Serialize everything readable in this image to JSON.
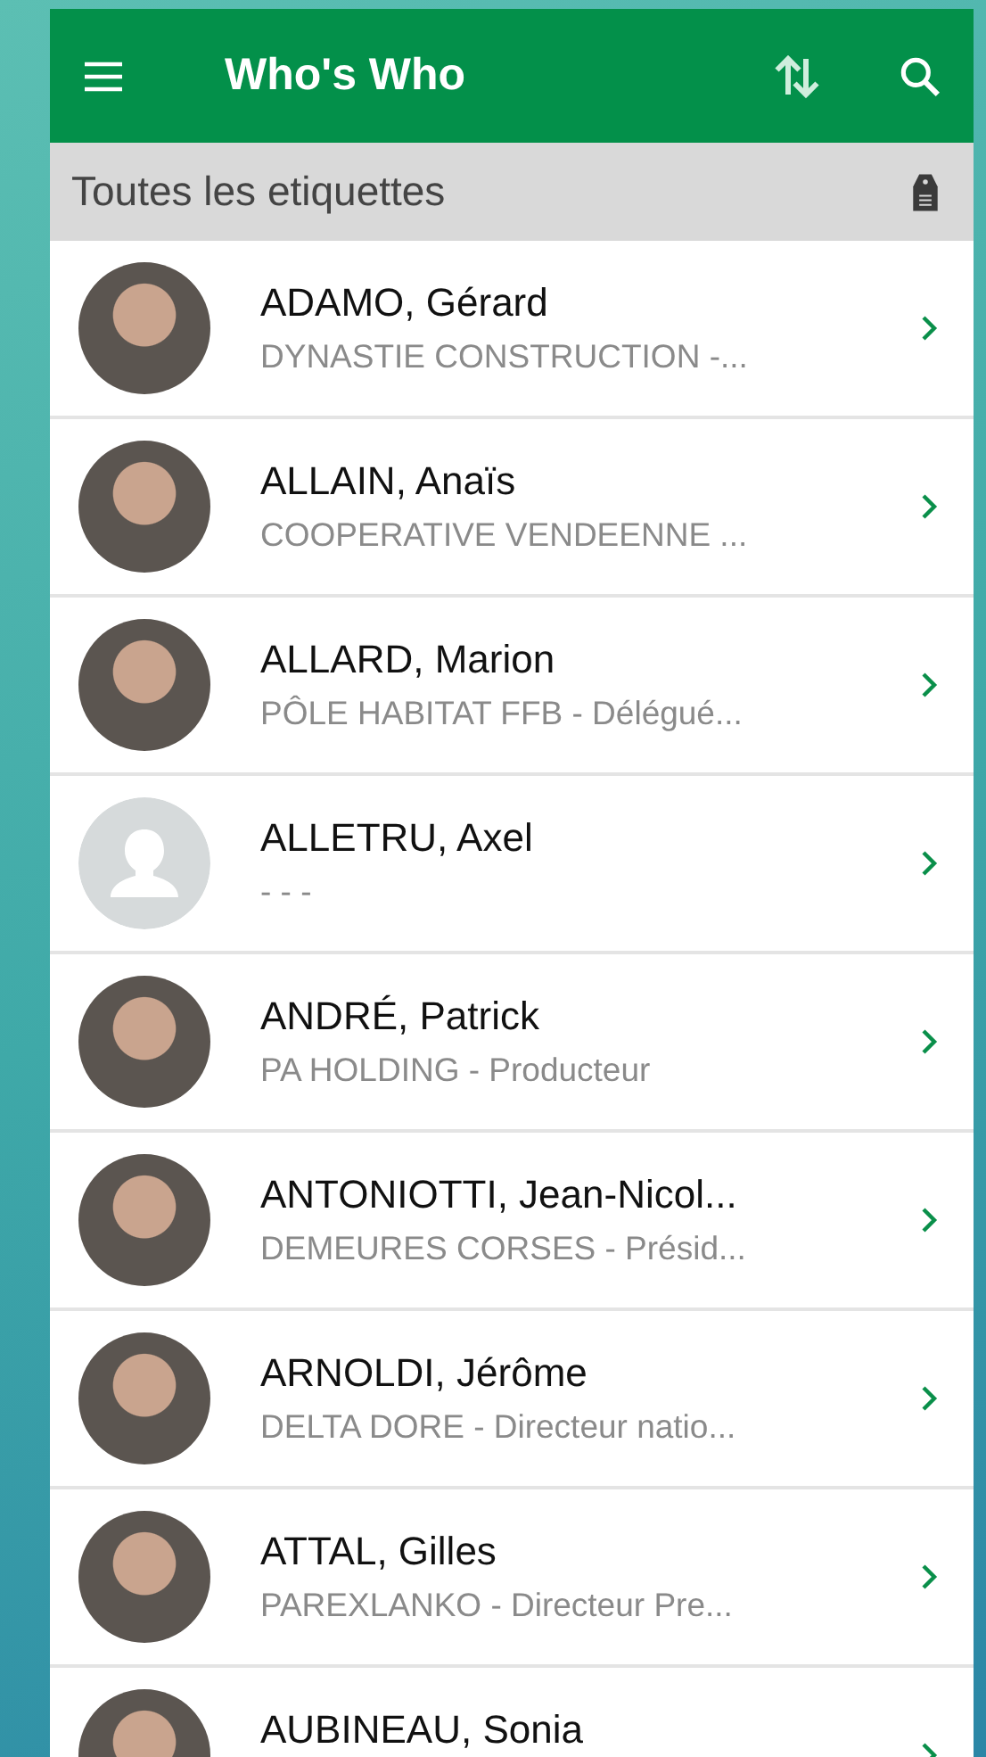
{
  "app_bar": {
    "title": "Who's Who"
  },
  "filter_bar": {
    "label": "Toutes les etiquettes"
  },
  "contacts": [
    {
      "name": "ADAMO, Gérard",
      "subtitle": "DYNASTIE CONSTRUCTION -...",
      "kind": "photo"
    },
    {
      "name": "ALLAIN, Anaïs",
      "subtitle": "COOPERATIVE VENDEENNE ...",
      "kind": "photo"
    },
    {
      "name": "ALLARD, Marion",
      "subtitle": "PÔLE HABITAT FFB - Délégué...",
      "kind": "photo"
    },
    {
      "name": "ALLETRU, Axel",
      "subtitle": "- - -",
      "kind": "placeholder"
    },
    {
      "name": "ANDRÉ, Patrick",
      "subtitle": "PA HOLDING - Producteur",
      "kind": "photo"
    },
    {
      "name": "ANTONIOTTI, Jean-Nicol...",
      "subtitle": "DEMEURES CORSES - Présid...",
      "kind": "photo"
    },
    {
      "name": "ARNOLDI, Jérôme",
      "subtitle": "DELTA DORE - Directeur natio...",
      "kind": "photo"
    },
    {
      "name": "ATTAL, Gilles",
      "subtitle": "PAREXLANKO - Directeur Pre...",
      "kind": "photo"
    },
    {
      "name": "AUBINEAU, Sonia",
      "kind": "photo"
    }
  ]
}
